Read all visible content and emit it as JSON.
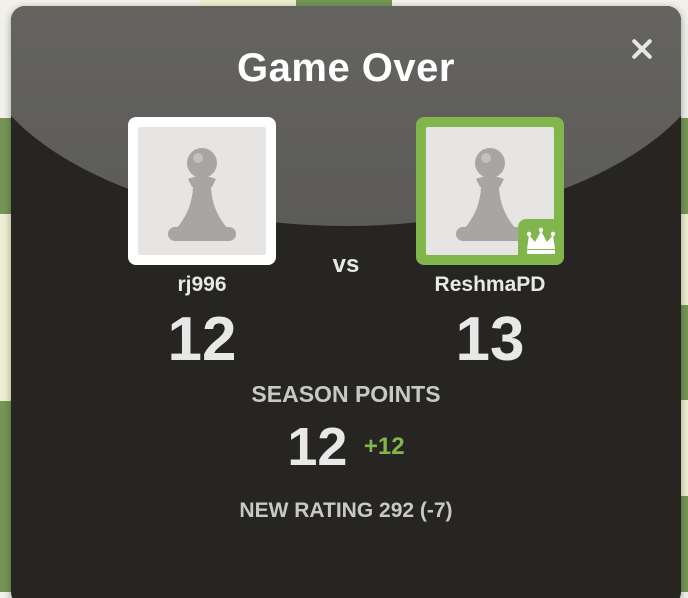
{
  "modal": {
    "title": "Game Over"
  },
  "players": {
    "left": {
      "name": "rj996",
      "score": "12",
      "avatar_icon": "pawn-icon",
      "frame_color": "#ffffff"
    },
    "right": {
      "name": "ReshmaPD",
      "score": "13",
      "avatar_icon": "pawn-icon",
      "badge_icon": "crown-icon",
      "frame_color": "#81b64c"
    }
  },
  "versus_label": "vs",
  "season": {
    "label": "SEASON POINTS",
    "points": "12",
    "delta": "+12"
  },
  "rating": {
    "text": "NEW RATING 292 (-7)"
  },
  "colors": {
    "accent_green": "#81b64c",
    "modal_bg": "#262522",
    "header_bg": "#6b6a67"
  }
}
